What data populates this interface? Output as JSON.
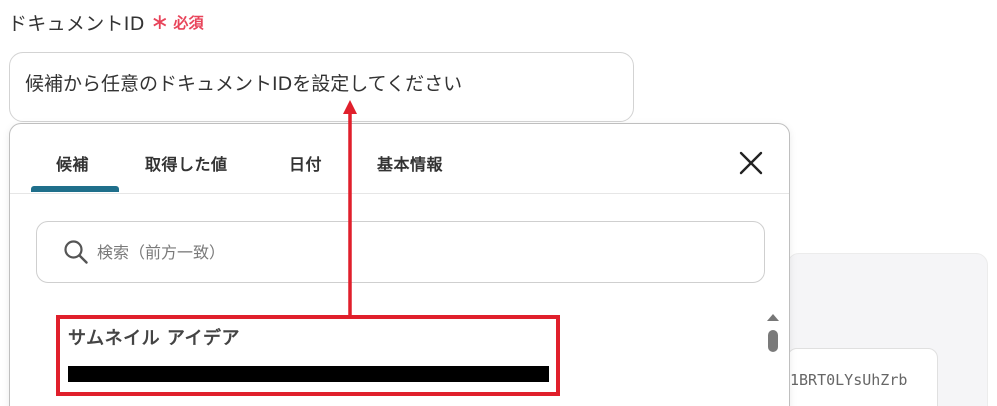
{
  "field": {
    "label": "ドキュメントID",
    "required_star": "∗",
    "required_text": "必須"
  },
  "main_input": {
    "placeholder": "候補から任意のドキュメントIDを設定してください"
  },
  "dropdown": {
    "tabs": [
      {
        "label": "候補",
        "active": true
      },
      {
        "label": "取得した値",
        "active": false
      },
      {
        "label": "日付",
        "active": false
      },
      {
        "label": "基本情報",
        "active": false
      }
    ],
    "search": {
      "placeholder": "検索（前方一致）"
    },
    "options": [
      {
        "title": "サムネイル アイデア",
        "id_redacted": true
      }
    ]
  },
  "background_field": {
    "value_fragment": "1BRT0LYsUhZrb"
  },
  "colors": {
    "required": "#e8445a",
    "tab_active_underline": "#1f6f8b",
    "annotation": "#e01f2b"
  },
  "icons": {
    "search": "search-icon",
    "close": "close-icon"
  }
}
